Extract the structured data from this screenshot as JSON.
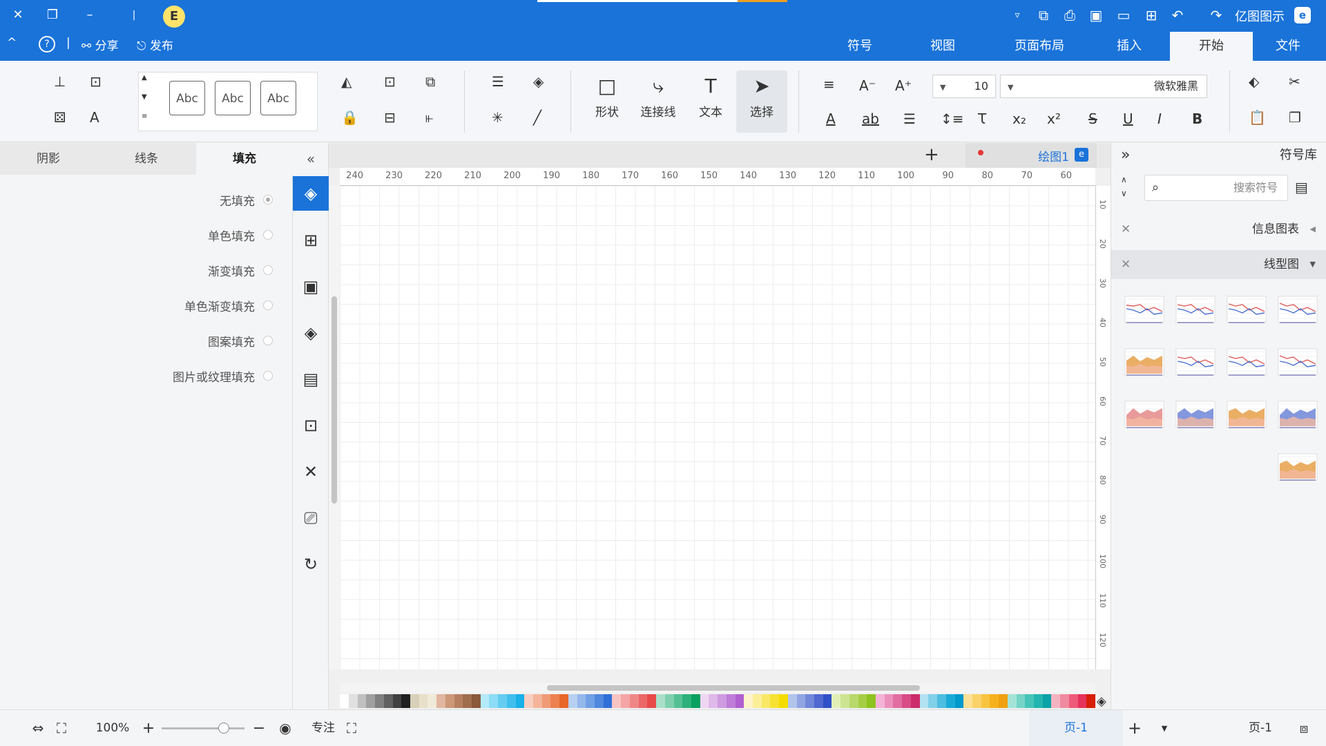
{
  "app": {
    "title": "亿图图示",
    "logo_letter": "e",
    "badge_letter": "E"
  },
  "header": {
    "publish_label": "发布",
    "share_label": "分享",
    "help_label": "?"
  },
  "menu_tabs": [
    "文件",
    "开始",
    "插入",
    "页面布局",
    "视图",
    "符号"
  ],
  "ribbon": {
    "font_family": "微软雅黑",
    "font_size": "10",
    "tools": {
      "select": "选择",
      "text": "文本",
      "connector": "连接线",
      "shape": "形状"
    },
    "style_sample": "Abc"
  },
  "left_panel": {
    "tabs": [
      "填充",
      "线条",
      "阴影"
    ],
    "fill_options": [
      "无填充",
      "单色填充",
      "渐变填充",
      "单色渐变填充",
      "图案填充",
      "图片或纹理填充"
    ]
  },
  "canvas": {
    "doc_tab": "绘图1",
    "h_ruler": [
      "60",
      "70",
      "80",
      "90",
      "100",
      "110",
      "120",
      "130",
      "140",
      "150",
      "160",
      "170",
      "180",
      "190",
      "200",
      "210",
      "220",
      "230",
      "240"
    ],
    "v_ruler": [
      "10",
      "20",
      "30",
      "40",
      "50",
      "60",
      "70",
      "80",
      "90",
      "100",
      "110",
      "120"
    ],
    "palette": [
      "#d81e06",
      "#e6335b",
      "#ef5a7a",
      "#f08aa0",
      "#f5b3c2",
      "#0aa3a8",
      "#23b5b0",
      "#47c4b9",
      "#76d4c6",
      "#a4e4d6",
      "#f0a010",
      "#f6b21c",
      "#f8c440",
      "#fad269",
      "#fce095",
      "#0099cc",
      "#1aaad7",
      "#4dbde0",
      "#80d0e9",
      "#b3e2f2",
      "#cc2a6a",
      "#d94c86",
      "#e26ea1",
      "#eb90bc",
      "#f4b3d6",
      "#8fc31f",
      "#a5ce45",
      "#b9d96b",
      "#cde491",
      "#e1efb7",
      "#3050c8",
      "#4f69d1",
      "#7087da",
      "#91a5e3",
      "#b2c3ec",
      "#f5dc00",
      "#f7e233",
      "#f9e866",
      "#fbee99",
      "#fdf4cc",
      "#b060d0",
      "#bf7dd8",
      "#cf9be1",
      "#dfb9ea",
      "#efd7f3",
      "#08a060",
      "#2db07b",
      "#56c095",
      "#80d0b0",
      "#aae0ca",
      "#e84a4a",
      "#ec6868",
      "#f08787",
      "#f4a5a5",
      "#f8c3c3",
      "#2f6fd8",
      "#5088de",
      "#72a0e5",
      "#94b8ec",
      "#b6d0f2",
      "#e8682a",
      "#ec8250",
      "#f09b75",
      "#f4b59b",
      "#f8cfc0",
      "#1ab0e8",
      "#40bfed",
      "#66cdf1",
      "#8ddcf5",
      "#b3eaf9",
      "#8a5a3a",
      "#a06d4c",
      "#b68060",
      "#cc9878",
      "#e2b6a0",
      "#f0ead8",
      "#e8e0c8",
      "#d8d0b8",
      "#202020",
      "#404040",
      "#606060",
      "#808080",
      "#a0a0a0",
      "#c0c0c0",
      "#e0e0e0",
      "#ffffff"
    ]
  },
  "right_panel": {
    "title": "符号库",
    "search_placeholder": "搜索符号",
    "categories": [
      {
        "label": "信息图表",
        "expanded": false
      },
      {
        "label": "线型图",
        "expanded": true
      }
    ]
  },
  "status_bar": {
    "page_left": "页-1",
    "page_tab": "页-1",
    "focus_label": "专注",
    "zoom": "100%"
  }
}
